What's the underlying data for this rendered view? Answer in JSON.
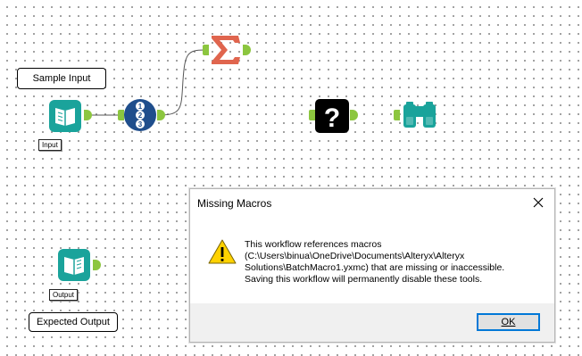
{
  "canvas": {
    "annotations": {
      "sample_input": "Sample Input",
      "expected_output": "Expected Output"
    },
    "tool_labels": {
      "input": "Input",
      "output": "Output"
    },
    "icons": {
      "input_tool": "book-input-icon",
      "record_id_tool": "record-id-icon",
      "summarize_tool": "summation-icon",
      "missing_macro_tool": "question-mark-icon",
      "browse_tool": "binoculars-icon",
      "output_tool": "book-output-icon"
    },
    "colors": {
      "input": "#1aa39b",
      "record_id": "#1f4e8c",
      "summarize": "#e0654e",
      "anchor": "#8cc63f",
      "browse": "#1aa39b"
    },
    "record_id_numbers": [
      "1",
      "2",
      "3"
    ]
  },
  "dialog": {
    "title": "Missing Macros",
    "message_lines": [
      "This workflow references macros",
      "(C:\\Users\\binua\\OneDrive\\Documents\\Alteryx\\Alteryx",
      "Solutions\\BatchMacro1.yxmc) that are missing or inaccessible.",
      "Saving this workflow will permanently disable these tools."
    ],
    "ok_label": "OK",
    "close_icon": "close-icon",
    "warning_icon": "warning-icon"
  }
}
